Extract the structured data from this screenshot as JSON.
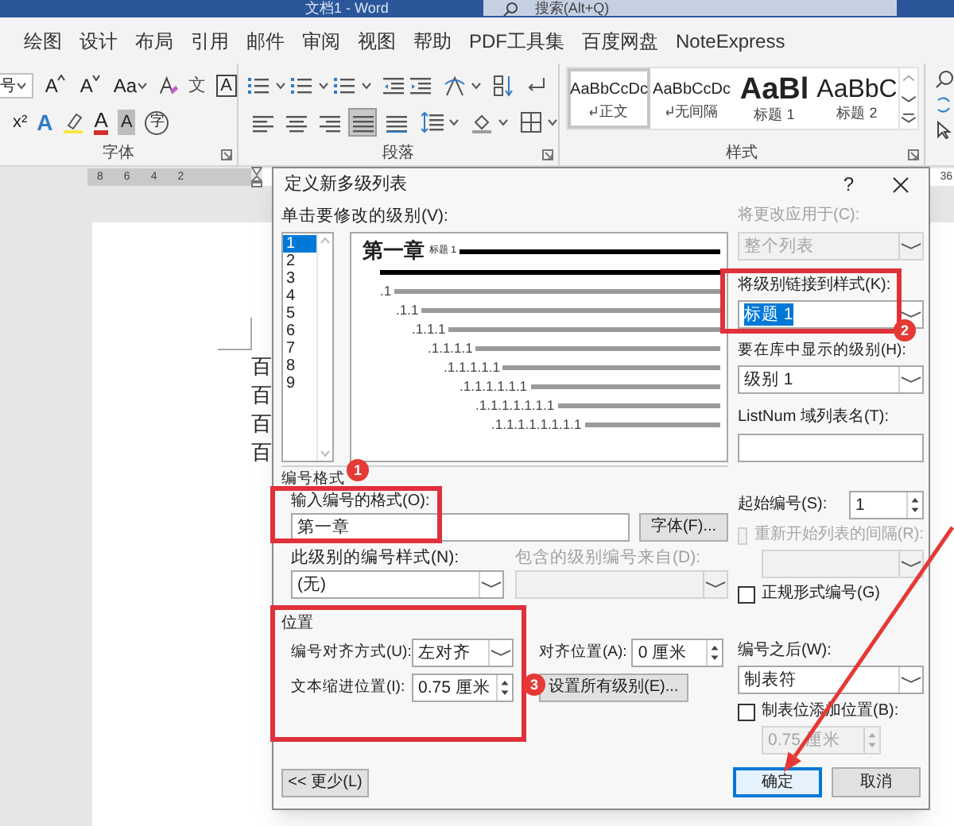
{
  "window": {
    "title": "文档1 - Word",
    "search": {
      "placeholder": "搜索(Alt+Q)"
    }
  },
  "ribbon_tabs": [
    "绘图",
    "设计",
    "布局",
    "引用",
    "邮件",
    "审阅",
    "视图",
    "帮助",
    "PDF工具集",
    "百度网盘",
    "NoteExpress"
  ],
  "ribbon": {
    "font_group": {
      "label": "字体",
      "size_value": "号",
      "row1": [
        {
          "kind": "grow",
          "label": "A"
        },
        {
          "kind": "shrink",
          "label": "A"
        },
        {
          "kind": "case",
          "label": "Aa"
        },
        {
          "kind": "clear"
        },
        {
          "kind": "phonetic",
          "label": "文"
        },
        {
          "kind": "border",
          "label": "A"
        }
      ],
      "row2": [
        {
          "kind": "superscript",
          "label": "x²"
        },
        {
          "kind": "effects",
          "label": "A"
        },
        {
          "kind": "highlight"
        },
        {
          "kind": "color",
          "label": "A"
        },
        {
          "kind": "shade",
          "label": "A"
        },
        {
          "kind": "enclose",
          "label": "字"
        }
      ]
    },
    "paragraph_group": {
      "label": "段落",
      "alignment_buttons": [
        {
          "kind": "left",
          "selected": false
        },
        {
          "kind": "center",
          "selected": false
        },
        {
          "kind": "right",
          "selected": false
        },
        {
          "kind": "justify",
          "selected": true
        },
        {
          "kind": "distributed",
          "selected": false
        }
      ]
    },
    "styles_group": {
      "label": "样式",
      "styles": [
        {
          "preview": "AaBbCcDc",
          "name": "正文",
          "kind": "normal",
          "selected": true
        },
        {
          "preview": "AaBbCcDc",
          "name": "无间隔",
          "kind": "normal",
          "selected": false
        },
        {
          "preview": "AaBl",
          "name": "标题 1",
          "kind": "heading1",
          "selected": false
        },
        {
          "preview": "AaBbC",
          "name": "标题 2",
          "kind": "heading2",
          "selected": false
        }
      ]
    }
  },
  "ruler": {
    "numbers": [
      "8",
      "6",
      "4",
      "2"
    ],
    "right_number": "36"
  },
  "document": {
    "lines": [
      "百",
      "百",
      "百",
      "百"
    ]
  },
  "dialog": {
    "title": "定义新多级列表",
    "help": "?",
    "level_label": "单击要修改的级别(V):",
    "levels": [
      {
        "label": "1",
        "selected": true
      },
      {
        "label": "2",
        "selected": false
      },
      {
        "label": "3",
        "selected": false
      },
      {
        "label": "4",
        "selected": false
      },
      {
        "label": "5",
        "selected": false
      },
      {
        "label": "6",
        "selected": false
      },
      {
        "label": "7",
        "selected": false
      },
      {
        "label": "8",
        "selected": false
      },
      {
        "label": "9",
        "selected": false
      }
    ],
    "preview": {
      "heading": "第一章",
      "heading_style": "标题 1",
      "rows": [
        ".1",
        ".1.1",
        ".1.1.1",
        ".1.1.1.1",
        ".1.1.1.1.1",
        ".1.1.1.1.1.1",
        ".1.1.1.1.1.1.1",
        ".1.1.1.1.1.1.1.1"
      ]
    },
    "apply_to": {
      "label": "将更改应用于(C):",
      "kind": "select",
      "value": "整个列表",
      "disabled": true
    },
    "link_style": {
      "label": "将级别链接到样式(K):",
      "kind": "select",
      "value": "标题 1",
      "disabled": false,
      "text_selected": true
    },
    "gallery_level": {
      "label": "要在库中显示的级别(H):",
      "kind": "select",
      "value": "级别 1",
      "disabled": false
    },
    "listnum": {
      "label": "ListNum 域列表名(T):",
      "kind": "text",
      "disabled": false
    },
    "format_section": {
      "title": "编号格式",
      "format_input": {
        "label": "输入编号的格式(O):",
        "kind": "text",
        "value": "第一章",
        "disabled": false
      },
      "font_button": "字体(F)...",
      "number_style": {
        "label": "此级别的编号样式(N):",
        "kind": "select",
        "value": "(无)",
        "disabled": false
      },
      "include_level": {
        "label": "包含的级别编号来自(D):",
        "kind": "select",
        "disabled": true
      },
      "start_at": {
        "label": "起始编号(S):",
        "kind": "spin",
        "value": "1",
        "disabled": false
      },
      "restart": {
        "label": "重新开始列表的间隔(R):",
        "checked": false,
        "disabled": true
      },
      "restart_select": {
        "kind": "select",
        "disabled": true
      },
      "legal": {
        "label": "正规形式编号(G)",
        "checked": false,
        "disabled": false
      }
    },
    "position_section": {
      "title": "位置",
      "alignment": {
        "label": "编号对齐方式(U):",
        "kind": "select",
        "value": "左对齐",
        "disabled": false
      },
      "aligned_at": {
        "label": "对齐位置(A):",
        "kind": "spin",
        "value": "0 厘米",
        "disabled": false
      },
      "indent_at": {
        "label": "文本缩进位置(I):",
        "kind": "spin",
        "value": "0.75 厘米",
        "disabled": false
      },
      "set_all_button": "设置所有级别(E)...",
      "follow_with": {
        "label": "编号之后(W):",
        "kind": "select",
        "value": "制表符",
        "disabled": false
      },
      "add_tab": {
        "label": "制表位添加位置(B):",
        "checked": false,
        "disabled": false
      },
      "tab_at": {
        "kind": "spin",
        "value": "0.75 厘米",
        "disabled": true
      }
    },
    "buttons": {
      "less": "<< 更少(L)",
      "ok": "确定",
      "cancel": "取消"
    }
  },
  "annotations": {
    "badges": [
      "1",
      "2",
      "3"
    ]
  }
}
